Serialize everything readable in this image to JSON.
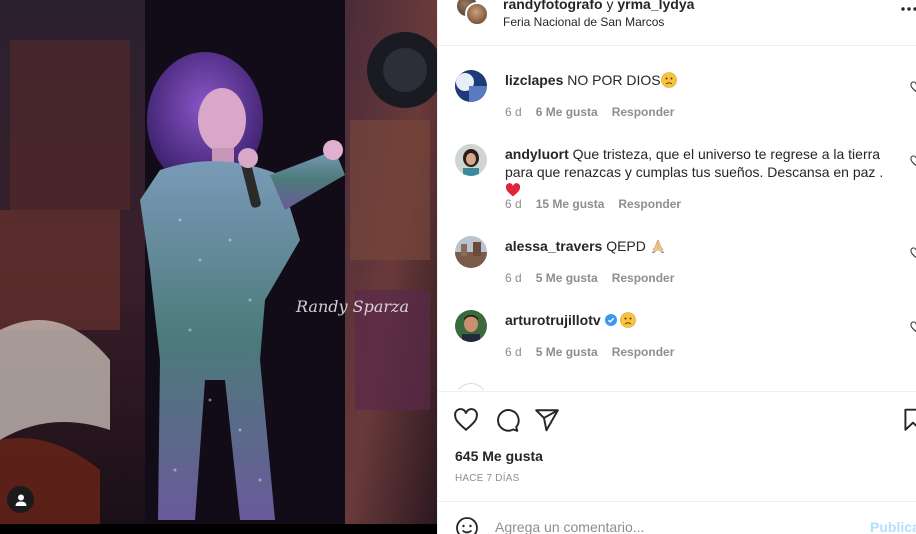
{
  "post": {
    "author_1": "randyfotografo",
    "joiner": " y ",
    "author_2": "yrma_lydya",
    "location": "Feria Nacional de San Marcos",
    "photo_watermark": "Randy Sparza"
  },
  "comments": [
    {
      "user": "lizclapes",
      "text": "NO POR DIOS",
      "emoji": "sad-face-emoji",
      "time": "6 d",
      "likes": "6 Me gusta",
      "reply": "Responder",
      "verified": false
    },
    {
      "user": "andyluort",
      "text": "Que tristeza, que el universo te regrese a la tierra para que renazcas y cumplas tus sueños. Descansa en paz .",
      "emoji": "red-heart-emoji",
      "time": "6 d",
      "likes": "15 Me gusta",
      "reply": "Responder",
      "verified": false
    },
    {
      "user": "alessa_travers",
      "text": "QEPD",
      "emoji": "praying-hands-emoji",
      "time": "6 d",
      "likes": "5 Me gusta",
      "reply": "Responder",
      "verified": false
    },
    {
      "user": "arturotrujillotv",
      "text": "",
      "emoji": "sad-face-emoji",
      "time": "6 d",
      "likes": "5 Me gusta",
      "reply": "Responder",
      "verified": true
    }
  ],
  "actions": {
    "likes_count": "645 Me gusta",
    "time_ago": "HACE 7 DÍAS"
  },
  "add_comment": {
    "placeholder": "Agrega un comentario...",
    "post_label": "Publicar"
  },
  "colors": {
    "accent_disabled": "#b2dffc",
    "verified": "#3897f0",
    "heart": "#ed4956",
    "secondary_text": "#8e8e8e"
  }
}
